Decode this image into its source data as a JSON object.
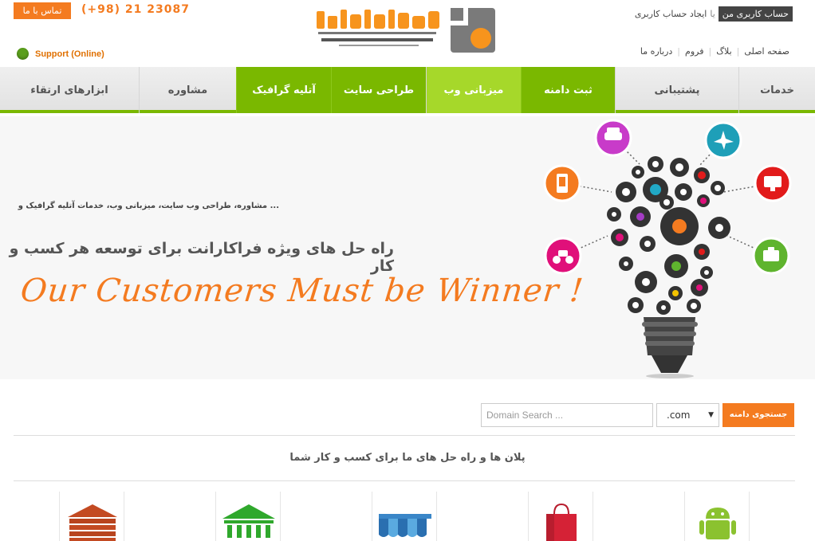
{
  "header": {
    "contact_label": "تماس با ما",
    "phone": "(+98) 21 23087",
    "support_label": "Support (Online)",
    "account_mine": "حساب کاربری من",
    "account_or": "یا",
    "account_create": "ایجاد حساب کاربری",
    "links": [
      "صفحه اصلی",
      "بلاگ",
      "فروم",
      "درباره ما"
    ]
  },
  "nav": {
    "items": [
      {
        "label": "خدمات",
        "style": "plain"
      },
      {
        "label": "پشتیبانی",
        "style": "plain"
      },
      {
        "label": "ثبت دامنه",
        "style": "green"
      },
      {
        "label": "میزبانی وب",
        "style": "active"
      },
      {
        "label": "طراحی سایت",
        "style": "green"
      },
      {
        "label": "آتلیه گرافیک",
        "style": "green"
      },
      {
        "label": "مشاوره",
        "style": "plain"
      },
      {
        "label": "ابزارهای ارتقاء",
        "style": "plain"
      }
    ]
  },
  "hero": {
    "subtitle": "... مشاوره، طراحی وب سایت، میزبانی وب، خدمات آتلیه گرافیک و",
    "title": "راه حل های ویژه فراکارانت برای توسعه هر کسب و کار",
    "slogan": "Our Customers Must be Winner !"
  },
  "domain": {
    "button_label": "جستجوی دامنه",
    "tld": ".com",
    "placeholder": "Domain Search ..."
  },
  "plans": {
    "title": "پلان ها و راه حل های ما برای کسب و کار شما"
  },
  "products": [
    {
      "icon": "bricks-icon"
    },
    {
      "icon": "bank-icon"
    },
    {
      "icon": "awning-icon"
    },
    {
      "icon": "shopping-bag-icon"
    },
    {
      "icon": "android-icon"
    }
  ],
  "colors": {
    "accent_orange": "#f47b20",
    "nav_green": "#7ab800",
    "nav_active": "#a6d82a",
    "support_green": "#5a9e1c"
  }
}
